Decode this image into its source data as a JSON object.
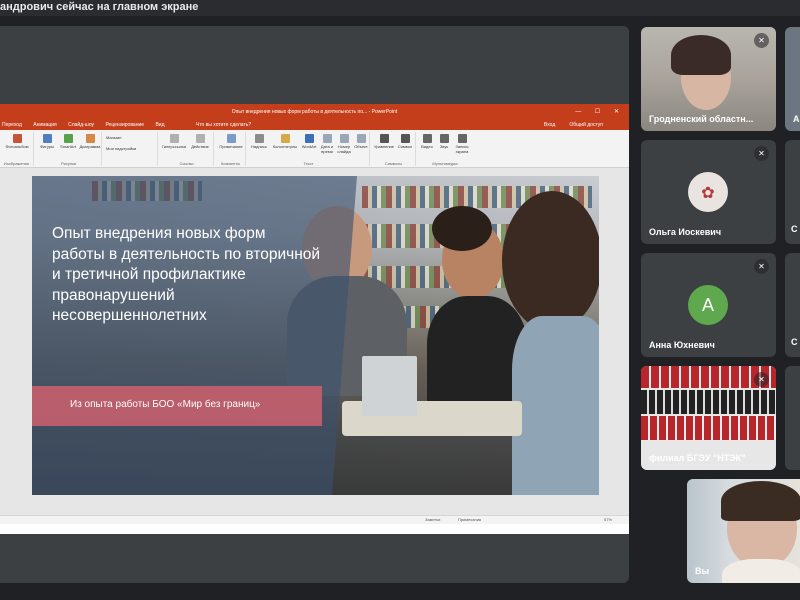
{
  "banner": {
    "text": "андрович сейчас на главном экране"
  },
  "ppt": {
    "window_title": "Опыт внедрения новых форм работы в деятельность по... - PowerPoint",
    "window_controls": "— ☐ ✕",
    "tabs": [
      "Переход",
      "Анимация",
      "Слайд-шоу",
      "Рецензирование",
      "Вид"
    ],
    "search_hint": "Что вы хотите сделать?",
    "account": "Вход",
    "share": "Общий доступ",
    "groups": [
      "Изображения",
      "Рисунки",
      "Комменты",
      "Ссылки",
      "Текст",
      "Символы",
      "Мультимедиа"
    ],
    "buttons": [
      "Фотоальбом",
      "Фигуры",
      "SmartArt",
      "Диаграмма",
      "Магазин",
      "Мои надстройки",
      "Гиперссылка",
      "Действие",
      "Примечание",
      "Надпись",
      "Колонтитулы",
      "WordArt",
      "Дата и время",
      "Номер слайда",
      "Объект",
      "Уравнение",
      "Символ",
      "Видео",
      "Звук",
      "Запись экрана"
    ],
    "status": {
      "notes": "Заметки",
      "comments": "Примечания",
      "zoom": "57%"
    }
  },
  "slide": {
    "title": "Опыт внедрения новых форм работы в деятельность по вторичной  и третичной профилактике правонарушений несовершеннолетних",
    "subtitle": "Из опыта работы БОО «Мир без границ»"
  },
  "participants": [
    {
      "name": "Гродненский областн...",
      "type": "camera"
    },
    {
      "name": "Ольга Иоскевич",
      "type": "photo"
    },
    {
      "name": "Анна Юхневич",
      "type": "letter",
      "letter": "А",
      "color": "#5fa84d"
    },
    {
      "name": "филиал БГЭУ \"НТЭК\"",
      "type": "camera"
    },
    {
      "name": "Вы",
      "type": "camera"
    }
  ],
  "edge_tiles": {
    "top_letter": "А",
    "c_letter": "C"
  },
  "icons": {
    "mic": "mic-off-icon"
  }
}
